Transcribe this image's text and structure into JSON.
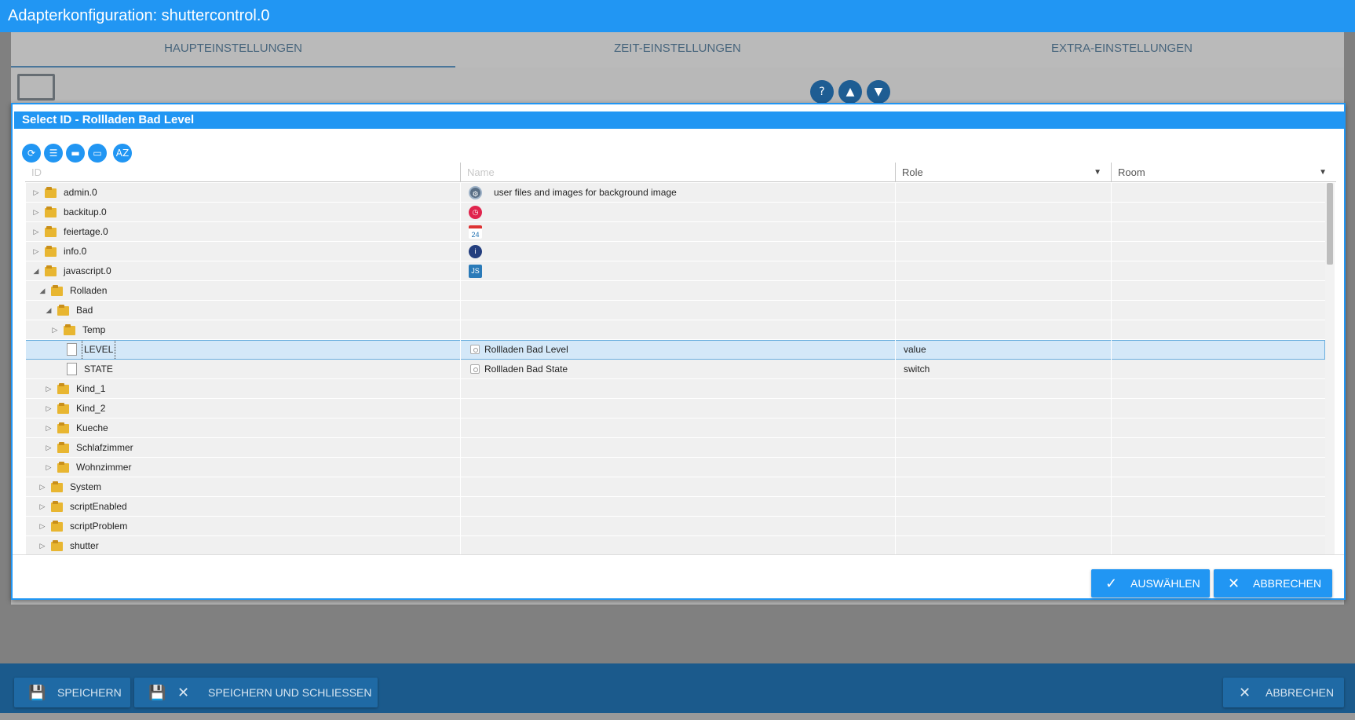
{
  "window": {
    "title": "Adapterkonfiguration: shuttercontrol.0"
  },
  "tabs": [
    {
      "label": "HAUPTEINSTELLUNGEN",
      "active": true
    },
    {
      "label": "ZEIT-EINSTELLUNGEN",
      "active": false
    },
    {
      "label": "EXTRA-EINSTELLUNGEN",
      "active": false
    }
  ],
  "footer": {
    "save": "SPEICHERN",
    "save_close": "SPEICHERN UND SCHLIESSEN",
    "cancel": "ABBRECHEN"
  },
  "dialog": {
    "title": "Select ID - Rollladen Bad Level",
    "toolbar": [
      "refresh-icon",
      "list-icon",
      "folder-icon",
      "folder-open-icon",
      "sort-az-icon"
    ],
    "columns": {
      "id_placeholder": "ID",
      "name_placeholder": "Name",
      "role": "Role",
      "room": "Room"
    },
    "rows": [
      {
        "id": "admin.0",
        "name": "user files and images for background image",
        "role": "",
        "room": "",
        "icon": "admin-icon"
      },
      {
        "id": "backitup.0",
        "name": "",
        "role": "",
        "room": "",
        "icon": "backitup-icon"
      },
      {
        "id": "feiertage.0",
        "name": "",
        "role": "",
        "room": "",
        "icon": "calendar-icon"
      },
      {
        "id": "info.0",
        "name": "",
        "role": "",
        "room": "",
        "icon": "info-icon"
      },
      {
        "id": "javascript.0",
        "name": "",
        "role": "",
        "room": "",
        "icon": "javascript-icon"
      },
      {
        "id": "Rolladen",
        "name": "",
        "role": "",
        "room": ""
      },
      {
        "id": "Bad",
        "name": "",
        "role": "",
        "room": ""
      },
      {
        "id": "Temp",
        "name": "",
        "role": "",
        "room": ""
      },
      {
        "id": "LEVEL",
        "name": "Rollladen Bad Level",
        "role": "value",
        "room": ""
      },
      {
        "id": "STATE",
        "name": "Rollladen Bad State",
        "role": "switch",
        "room": ""
      },
      {
        "id": "Kind_1",
        "name": "",
        "role": "",
        "room": ""
      },
      {
        "id": "Kind_2",
        "name": "",
        "role": "",
        "room": ""
      },
      {
        "id": "Kueche",
        "name": "",
        "role": "",
        "room": ""
      },
      {
        "id": "Schlafzimmer",
        "name": "",
        "role": "",
        "room": ""
      },
      {
        "id": "Wohnzimmer",
        "name": "",
        "role": "",
        "room": ""
      },
      {
        "id": "System",
        "name": "",
        "role": "",
        "room": ""
      },
      {
        "id": "scriptEnabled",
        "name": "",
        "role": "",
        "room": ""
      },
      {
        "id": "scriptProblem",
        "name": "",
        "role": "",
        "room": ""
      },
      {
        "id": "shutter",
        "name": "",
        "role": "",
        "room": ""
      }
    ],
    "buttons": {
      "select": "AUSWÄHLEN",
      "cancel": "ABBRECHEN"
    }
  },
  "colors": {
    "primary": "#2196f3",
    "selected_row": "#d4e8f8",
    "folder": "#e8b631"
  }
}
